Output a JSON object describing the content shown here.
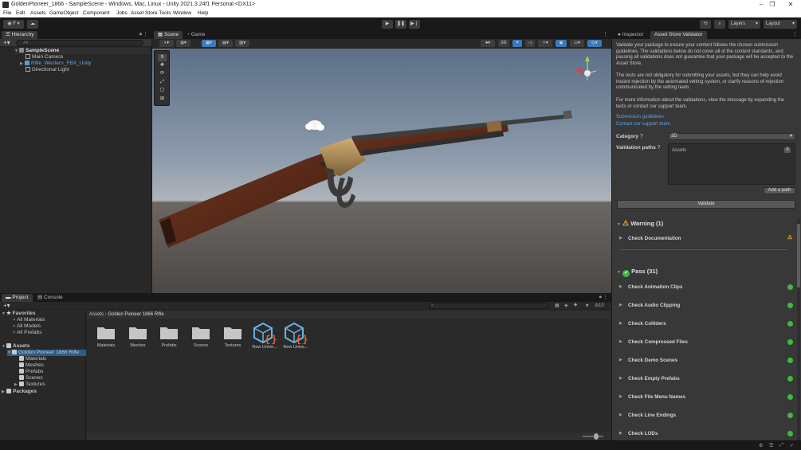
{
  "window": {
    "title": "GoldenPioneer_1866 - SampleScene - Windows, Mac, Linux - Unity 2021.3.24f1 Personal <DX11>"
  },
  "menu": [
    "File",
    "Edit",
    "Assets",
    "GameObject",
    "Component",
    "Jobs",
    "Asset Store Tools",
    "Window",
    "Help"
  ],
  "toolbar": {
    "account": "F",
    "layers": "Layers",
    "layout": "Layout"
  },
  "hierarchy": {
    "tab": "Hierarchy",
    "search_placeholder": "All",
    "items": [
      {
        "label": "SampleScene"
      },
      {
        "label": "Main Camera"
      },
      {
        "label": "Rifle_Western_FBX_Unity"
      },
      {
        "label": "Directional Light"
      }
    ]
  },
  "scene": {
    "tabs": [
      "Scene",
      "Game"
    ],
    "btn_2d": "2D"
  },
  "inspector": {
    "tabs": [
      "Inspector",
      "Asset Store Validator"
    ],
    "para1": "Validate your package to ensure your content follows the chosen submission guidelines. The validations below do not cover all of the content standards, and passing all validations does not guarantee that your package will be accepted to the Asset Store.",
    "para2": "The tests are not obligatory for submitting your assets, but they can help avoid instant rejection by the automated vetting system, or clarify reasons of rejection communicated by the vetting team.",
    "para3": "For more information about the validations, view the message by expanding the tests or contact our support team.",
    "link1": "Submission guidelines",
    "link2": "Contact our support team",
    "category_label": "Category",
    "category_value": "3D",
    "paths_label": "Validation paths",
    "path_value": "Assets",
    "remove_path": "X",
    "add_path": "Add a path",
    "validate": "Validate",
    "warning_header": "Warning (1)",
    "warning_items": [
      "Check Documentation"
    ],
    "pass_header": "Pass (31)",
    "pass_items": [
      "Check Animation Clips",
      "Check Audio Clipping",
      "Check Colliders",
      "Check Compressed Files",
      "Check Demo Scenes",
      "Check Empty Prefabs",
      "Check File Menu Names",
      "Check Line Endings",
      "Check LODs"
    ]
  },
  "project": {
    "tabs": [
      "Project",
      "Console"
    ],
    "search_placeholder": "",
    "hidden_count": "10",
    "favorites": {
      "label": "Favorites",
      "items": [
        "All Materials",
        "All Models",
        "All Prefabs"
      ]
    },
    "assets": {
      "label": "Assets",
      "root": "Golden Pioneer 1866 Rifle",
      "children": [
        "Materials",
        "Meshes",
        "Prefabs",
        "Scenes",
        "Textures"
      ]
    },
    "packages": "Packages",
    "breadcrumb": [
      "Assets",
      "Golden Pioneer 1866 Rifle"
    ],
    "grid": [
      {
        "label": "Materials",
        "icon": "folder-icon"
      },
      {
        "label": "Meshes",
        "icon": "folder-icon"
      },
      {
        "label": "Prefabs",
        "icon": "folder-icon"
      },
      {
        "label": "Scenes",
        "icon": "folder-icon"
      },
      {
        "label": "Textures",
        "icon": "folder-icon"
      },
      {
        "label": "New Unive...",
        "icon": "prefab-script-icon"
      },
      {
        "label": "New Unive...",
        "icon": "prefab-script-icon"
      }
    ]
  },
  "colors": {
    "accent": "#3a79bb",
    "warning": "#f0b429",
    "pass": "#3fb93f",
    "link": "#5ba3ec"
  }
}
